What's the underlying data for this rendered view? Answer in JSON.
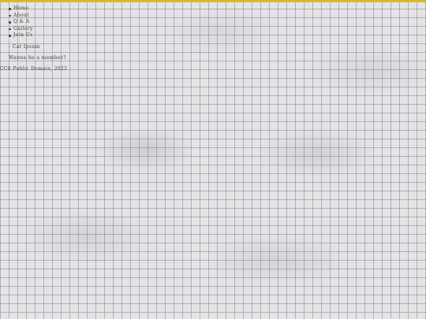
{
  "nav": {
    "items": [
      {
        "label": "Home"
      },
      {
        "label": "About"
      },
      {
        "label": "Q & A"
      },
      {
        "label": "Gallery"
      },
      {
        "label": "Join Us"
      }
    ]
  },
  "quote": {
    "text": "- Cat Ipsum"
  },
  "cta": {
    "text": "Wanna be a member?"
  },
  "footer": {
    "text": "CC0 Public Domain, 2022"
  },
  "colors": {
    "accent_bar": "#d9b92c",
    "background": "#e4e4e6",
    "text": "#3e3e3e"
  }
}
